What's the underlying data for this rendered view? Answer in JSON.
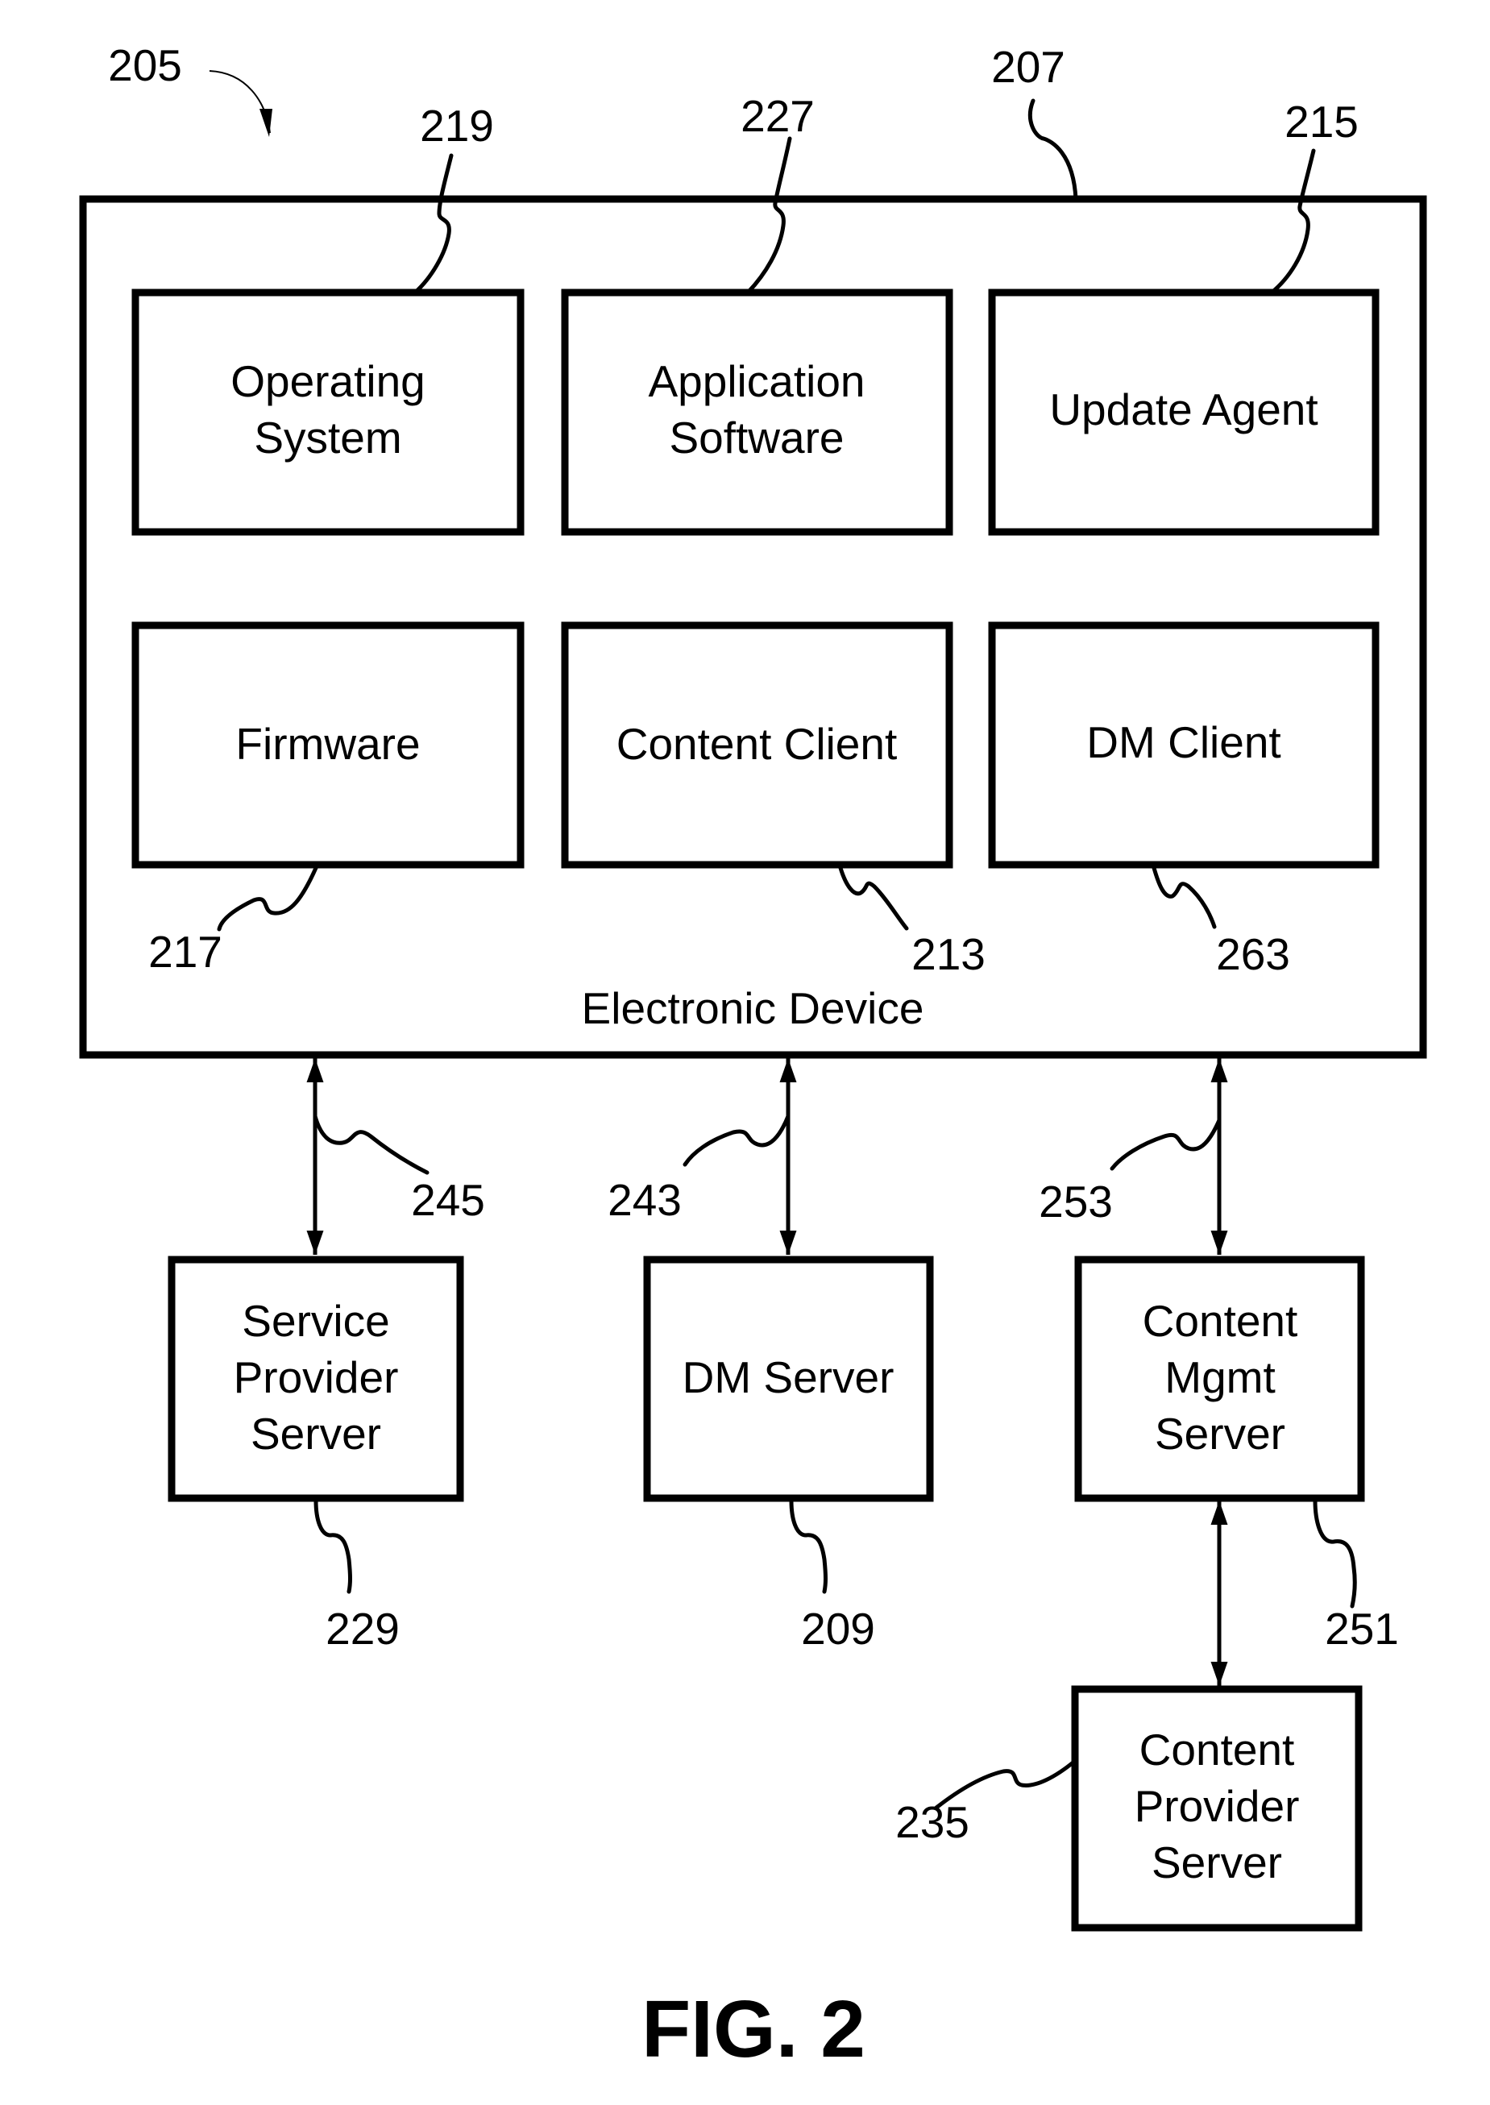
{
  "figure": {
    "caption": "FIG. 2",
    "system_ref": "205"
  },
  "device": {
    "label": "Electronic Device",
    "ref": "207",
    "components": [
      {
        "id": "operating-system",
        "lines": [
          "Operating",
          "System"
        ],
        "ref": "219"
      },
      {
        "id": "application-software",
        "lines": [
          "Application",
          "Software"
        ],
        "ref": "227"
      },
      {
        "id": "update-agent",
        "lines": [
          "Update Agent"
        ],
        "ref": "215"
      },
      {
        "id": "firmware",
        "lines": [
          "Firmware"
        ],
        "ref": "217"
      },
      {
        "id": "content-client",
        "lines": [
          "Content Client"
        ],
        "ref": "213"
      },
      {
        "id": "dm-client",
        "lines": [
          "DM Client"
        ],
        "ref": "263"
      }
    ]
  },
  "servers": [
    {
      "id": "service-provider-server",
      "lines": [
        "Service",
        "Provider",
        "Server"
      ],
      "ref": "229"
    },
    {
      "id": "dm-server",
      "lines": [
        "DM Server"
      ],
      "ref": "209"
    },
    {
      "id": "content-mgmt-server",
      "lines": [
        "Content",
        "Mgmt",
        "Server"
      ],
      "ref": "251"
    },
    {
      "id": "content-provider-server",
      "lines": [
        "Content",
        "Provider",
        "Server"
      ],
      "ref": "235"
    }
  ],
  "links": [
    {
      "id": "device-service-provider-link",
      "ref": "245",
      "bidirectional": true
    },
    {
      "id": "device-dm-server-link",
      "ref": "243",
      "bidirectional": true
    },
    {
      "id": "device-content-mgmt-link",
      "ref": "253",
      "bidirectional": true
    },
    {
      "id": "content-mgmt-content-provider-link",
      "bidirectional": true
    }
  ]
}
